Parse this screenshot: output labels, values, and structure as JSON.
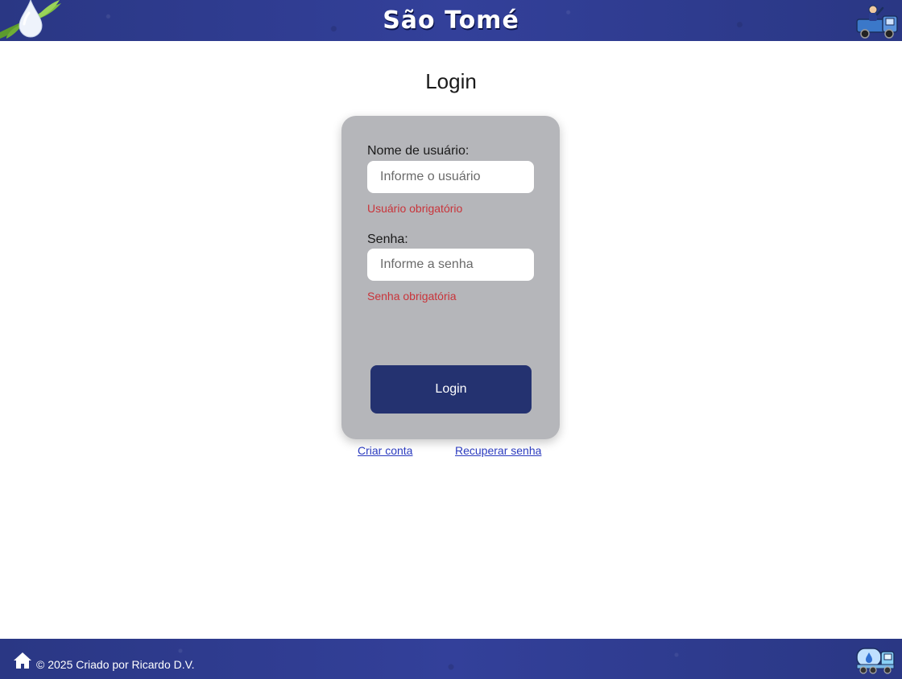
{
  "header": {
    "brand_title": "São Tomé",
    "drop_icon": "water-drop-leaves-icon",
    "truck_icon": "water-truck-driver-icon"
  },
  "login": {
    "title": "Login",
    "username_label": "Nome de usuário:",
    "username_placeholder": "Informe o usuário",
    "username_value": "",
    "username_error": "Usuário obrigatório",
    "password_label": "Senha:",
    "password_placeholder": "Informe a senha",
    "password_value": "",
    "password_error": "Senha obrigatória",
    "submit_label": "Login"
  },
  "links": {
    "create_account": "Criar conta",
    "recover_password": "Recuperar senha"
  },
  "footer": {
    "home_icon": "home-icon",
    "copyright": "© 2025 Criado por Ricardo D.V.",
    "truck_icon": "water-tank-truck-icon"
  },
  "colors": {
    "header_bg": "#2d3a8a",
    "card_bg": "#b5b6ba",
    "button_bg": "#243270",
    "error": "#c9343a",
    "link": "#2b3bbf"
  }
}
